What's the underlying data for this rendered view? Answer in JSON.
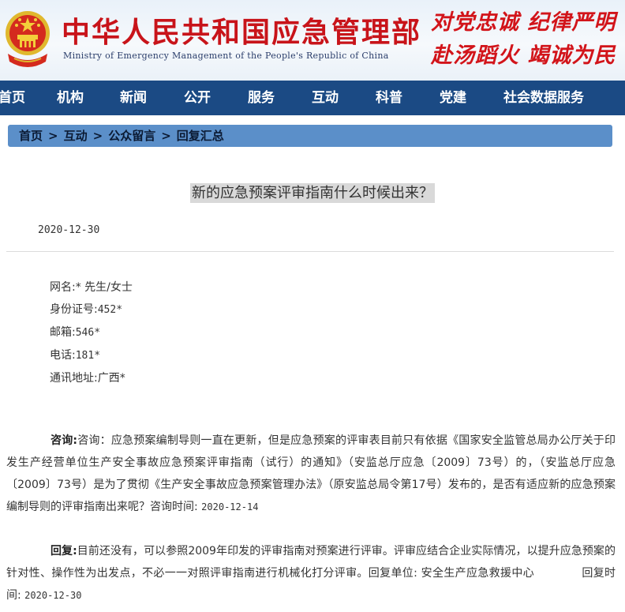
{
  "header": {
    "title": "中华人民共和国应急管理部",
    "subtitle": "Ministry of Emergency Management of the People's Republic of China",
    "motto_line1": "对党忠诚 纪律严明",
    "motto_line2": "赴汤蹈火 竭诚为民",
    "colors": {
      "title": "#c8141a",
      "nav_bg": "#1b4a84",
      "crumb_bg": "#5b8fc9"
    }
  },
  "nav": {
    "items": [
      "首页",
      "机构",
      "新闻",
      "公开",
      "服务",
      "互动",
      "科普",
      "党建",
      "社会数据服务"
    ]
  },
  "breadcrumb": {
    "items": [
      "首页",
      "互动",
      "公众留言",
      "回复汇总"
    ],
    "separator": ">"
  },
  "question": {
    "title": "新的应急预案评审指南什么时候出来？",
    "date": "2020-12-30"
  },
  "info": {
    "name_label": "网名:",
    "name_value": "* 先生/女士",
    "id_label": "身份证号:",
    "id_value": "452*",
    "email_label": "邮箱:",
    "email_value": "546*",
    "phone_label": "电话:",
    "phone_value": "181*",
    "address_label": "通讯地址:",
    "address_value": "广西*"
  },
  "consult": {
    "label": "咨询:",
    "text": "咨询：应急预案编制导则一直在更新，但是应急预案的评审表目前只有依据《国家安全监管总局办公厅关于印发生产经营单位生产安全事故应急预案评审指南（试行）的通知》（安监总厅应急〔2009〕73号）的，（安监总厅应急〔2009〕73号）是为了贯彻《生产安全事故应急预案管理办法》（原安监总局令第17号）发布的，是否有适应新的应急预案编制导则的评审指南出来呢？",
    "time_label": "咨询时间:",
    "time_value": "2020-12-14"
  },
  "reply": {
    "label": "回复:",
    "text": "目前还没有，可以参照2009年印发的评审指南对预案进行评审。评审应结合企业实际情况，以提升应急预案的针对性、操作性为出发点，不必一一对照评审指南进行机械化打分评审。",
    "unit_label": "回复单位:",
    "unit_value": "安全生产应急救援中心",
    "time_label": "回复时间:",
    "time_value": "2020-12-30"
  }
}
